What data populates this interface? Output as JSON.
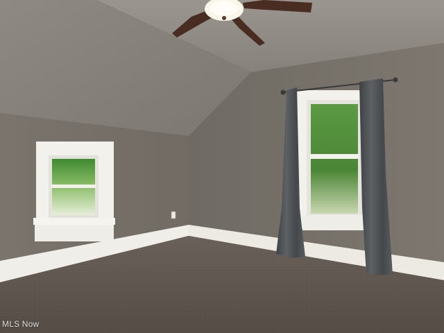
{
  "watermark": {
    "text": "MLS Now"
  },
  "colors": {
    "wall": "#7c766f",
    "wall_right": "#7a746c",
    "ceiling": "#8d8882",
    "trim": "#f2f0ea",
    "carpet": "#5c544d",
    "curtain": "#4f5254",
    "foliage": "#4f8a3a",
    "fan_blade": "#4a2d22",
    "fan_light": "#fbf6ea"
  },
  "scene": {
    "description_icons": [
      "ceiling-fan-icon",
      "window-icon",
      "curtain-icon",
      "outlet-icon"
    ]
  }
}
